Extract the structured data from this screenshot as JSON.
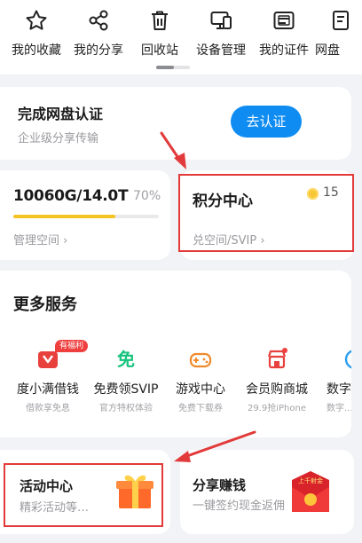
{
  "toolbar": {
    "items": [
      {
        "label": "我的收藏",
        "icon": "star-icon"
      },
      {
        "label": "我的分享",
        "icon": "share-icon"
      },
      {
        "label": "回收站",
        "icon": "trash-icon"
      },
      {
        "label": "设备管理",
        "icon": "devices-icon"
      },
      {
        "label": "我的证件",
        "icon": "id-card-icon"
      },
      {
        "label": "网盘",
        "icon": "cloud-drive-icon"
      }
    ]
  },
  "verify": {
    "title": "完成网盘认证",
    "subtitle": "企业级分享传输",
    "button": "去认证"
  },
  "storage": {
    "value": "10060G/14.0T",
    "percent": "70%",
    "used_fraction": 0.7,
    "link": "管理空间 ›"
  },
  "points": {
    "title": "积分中心",
    "count": "15",
    "subtitle": "兑空间/SVIP ›"
  },
  "services": {
    "title": "更多服务",
    "items": [
      {
        "name": "度小满借钱",
        "desc": "借款享免息",
        "badge": "有福利"
      },
      {
        "name": "免费领SVIP",
        "desc": "官方特权体验",
        "icon_text": "免"
      },
      {
        "name": "游戏中心",
        "desc": "免费下载券"
      },
      {
        "name": "会员购商城",
        "desc": "29.9抢iPhone"
      },
      {
        "name": "数字",
        "desc": "数字..."
      }
    ]
  },
  "activity": {
    "title": "活动中心",
    "subtitle": "精彩活动等…"
  },
  "share": {
    "title": "分享赚钱",
    "subtitle": "一键签约现金返佣",
    "envelope_text": "上千射金"
  },
  "colors": {
    "accent": "#0f8cf2",
    "highlight": "#e23a3a",
    "progress": "#f5c422"
  }
}
